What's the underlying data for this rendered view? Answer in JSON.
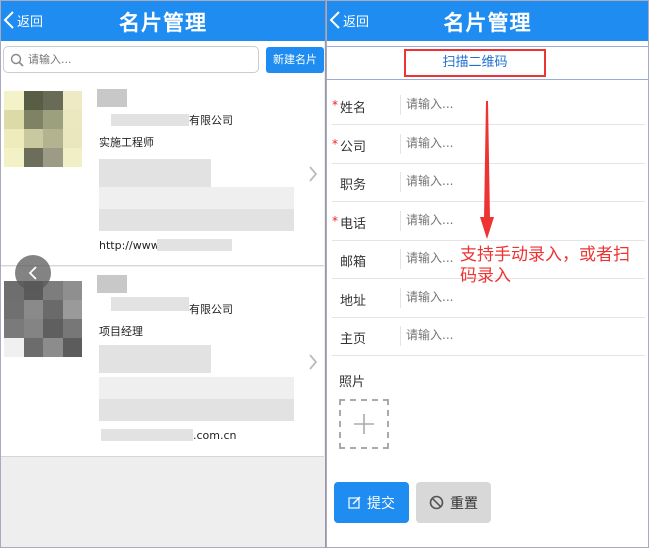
{
  "left": {
    "header": {
      "back_label": "返回",
      "title": "名片管理"
    },
    "search": {
      "placeholder": "请输入..."
    },
    "new_card_label": "新建名片",
    "cards": [
      {
        "company_suffix": "有限公司",
        "position": "实施工程师",
        "url_prefix": "http://www."
      },
      {
        "company_suffix": "有限公司",
        "position": "项目经理",
        "url_suffix": ".com.cn"
      }
    ]
  },
  "right": {
    "header": {
      "back_label": "返回",
      "title": "名片管理"
    },
    "scan_label": "扫描二维码",
    "required_mark": "*",
    "fields": [
      {
        "label": "姓名",
        "required": true,
        "placeholder": "请输入..."
      },
      {
        "label": "公司",
        "required": true,
        "placeholder": "请输入..."
      },
      {
        "label": "职务",
        "required": false,
        "placeholder": "请输入..."
      },
      {
        "label": "电话",
        "required": true,
        "placeholder": "请输入..."
      },
      {
        "label": "邮箱",
        "required": false,
        "placeholder": "请输入..."
      },
      {
        "label": "地址",
        "required": false,
        "placeholder": "请输入..."
      },
      {
        "label": "主页",
        "required": false,
        "placeholder": "请输入..."
      }
    ],
    "photo_label": "照片",
    "submit_label": "提交",
    "reset_label": "重置",
    "annotation": {
      "line1": "支持手动录入，或者扫",
      "line2": "码录入"
    }
  },
  "colors": {
    "accent": "#1e8cf0",
    "annotation": "#ee3333",
    "required": "#ee2222"
  },
  "icons": [
    "back-chevron-icon",
    "search-icon",
    "chevron-right-icon",
    "carousel-prev-icon",
    "plus-icon",
    "edit-icon",
    "ban-icon",
    "annotation-arrow"
  ]
}
